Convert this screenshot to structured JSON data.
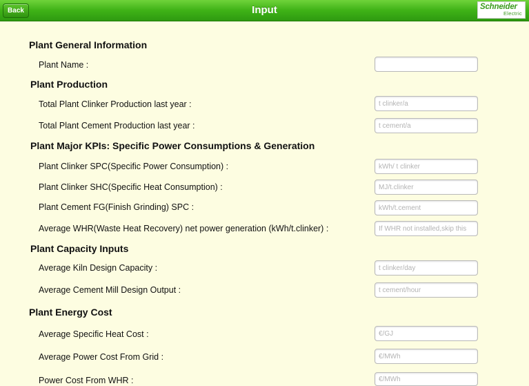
{
  "header": {
    "back_label": "Back",
    "title": "Input",
    "logo_line1": "Schneider",
    "logo_line2": "Electric"
  },
  "sections": {
    "general": "Plant General Information",
    "production": "Plant Production",
    "kpis": "Plant Major KPIs: Specific Power Consumptions & Generation",
    "capacity": "Plant Capacity Inputs",
    "energy": "Plant Energy Cost"
  },
  "fields": {
    "plant_name": {
      "label": "Plant Name :",
      "value": "",
      "placeholder": ""
    },
    "clinker_production": {
      "label": "Total Plant Clinker Production last year :",
      "value": "",
      "placeholder": "t clinker/a"
    },
    "cement_production": {
      "label": "Total Plant Cement  Production last year :",
      "value": "",
      "placeholder": "t cement/a"
    },
    "clinker_spc": {
      "label": "Plant Clinker SPC(Specific Power Consumption) :",
      "value": "",
      "placeholder": "kWh/ t clinker"
    },
    "clinker_shc": {
      "label": "Plant Clinker SHC(Specific Heat Consumption) :",
      "value": "",
      "placeholder": "MJ/t.clinker"
    },
    "cement_fg_spc": {
      "label": "Plant Cement FG(Finish Grinding) SPC  :",
      "value": "",
      "placeholder": "kWh/t.cement"
    },
    "whr_generation": {
      "label": "Average WHR(Waste Heat Recovery) net power generation (kWh/t.clinker) :",
      "value": "",
      "placeholder": "If WHR not installed,skip this"
    },
    "kiln_capacity": {
      "label": "Average Kiln Design Capacity  :",
      "value": "",
      "placeholder": "t clinker/day"
    },
    "cement_mill_output": {
      "label": "Average Cement Mill Design Output  :",
      "value": "",
      "placeholder": "t cement/hour"
    },
    "heat_cost": {
      "label": "Average Specific Heat Cost :",
      "value": "",
      "placeholder": "€/GJ"
    },
    "grid_power_cost": {
      "label": "Average Power Cost From Grid :",
      "value": "",
      "placeholder": "€/MWh"
    },
    "whr_power_cost": {
      "label": "Power Cost From WHR :",
      "value": "",
      "placeholder": "€/MWh"
    }
  },
  "colors": {
    "header_green": "#3fb217",
    "background": "#fdfde1",
    "brand_green": "#3a9a1c"
  }
}
